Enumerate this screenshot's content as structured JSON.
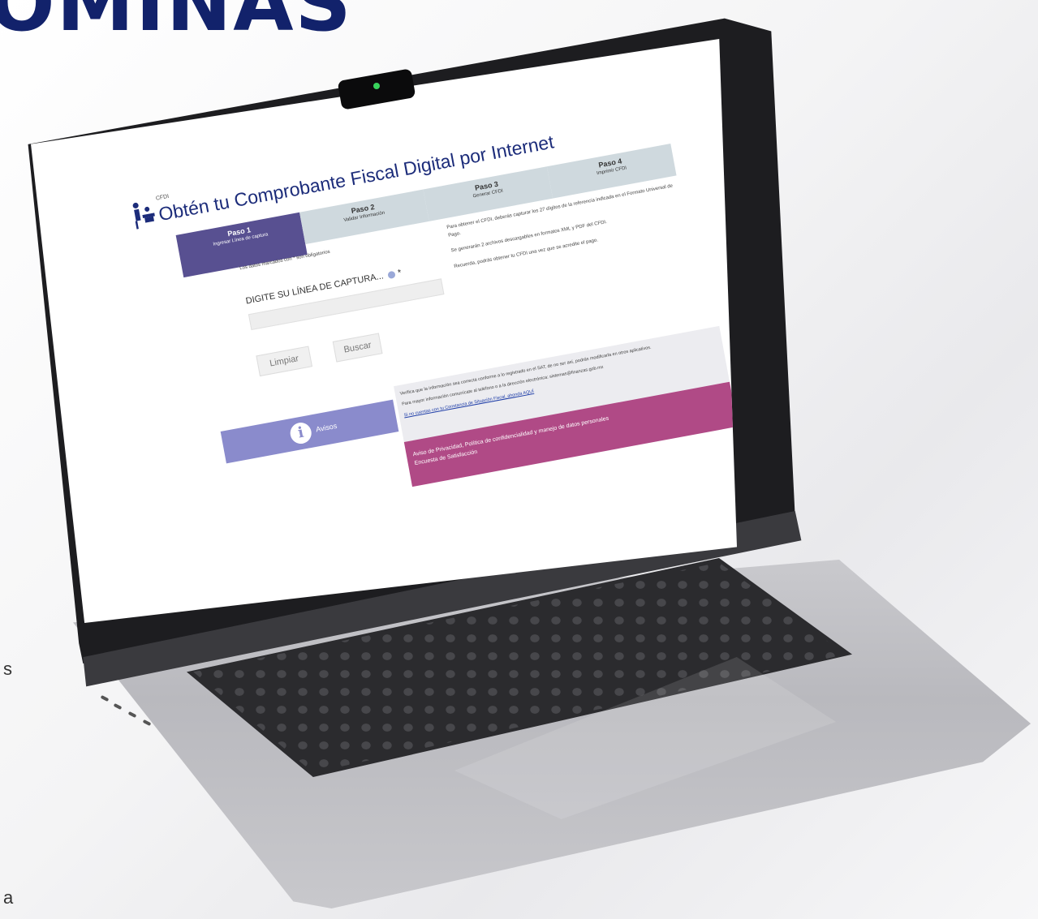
{
  "page": {
    "headline": "ÓMINAS",
    "edge_letters": [
      "s",
      "a"
    ]
  },
  "app": {
    "tag": "CFDI",
    "title": "Obtén tu Comprobante Fiscal Digital por Internet",
    "steps": [
      {
        "title": "Paso 1",
        "subtitle": "Ingresar Línea de captura",
        "active": true
      },
      {
        "title": "Paso 2",
        "subtitle": "Validar Información",
        "active": false
      },
      {
        "title": "Paso 3",
        "subtitle": "Generar CFDI",
        "active": false
      },
      {
        "title": "Paso 4",
        "subtitle": "Imprimir CFDI",
        "active": false
      }
    ],
    "required_note": "Los datos marcados con * son obligatorios",
    "capture_label": "DIGITE SU LÍNEA DE CAPTURA... ",
    "required_mark": "*",
    "capture_value": "",
    "buttons": {
      "clear": "Limpiar",
      "search": "Buscar"
    },
    "instructions": [
      "Para obtener el CFDI, deberás capturar los 27 dígitos de la referencia indicada en el Formato Universal de Pago.",
      "Se generarán 2 archivos descargables en formatos XML y PDF del CFDI.",
      "Recuerda, podrás obtener tu CFDI una vez que se acredite el pago."
    ],
    "notice_label": "Avisos",
    "notices": [
      "Verifica que la información sea correcta conforme a lo registrado en el SAT, de no ser así, podrás modificarla en otros aplicativos.",
      "Para mayor información comunícate al teléfono o a la dirección electrónica: sistemas@finanzas.gob.mx",
      "Si no cuentas con tu Constancia de Situación Fiscal, ahonda AQUÍ"
    ],
    "privacy_links": [
      "Aviso de Privacidad, Política de confidencialidad y manejo de datos personales",
      "Encuesta de Satisfacción"
    ]
  },
  "colors": {
    "headline": "#12226b",
    "step_active": "#585091",
    "step_inactive": "#cfd9de",
    "notice": "#8a8bcc",
    "privacy": "#b04a86",
    "camera_led": "#38d35c"
  }
}
